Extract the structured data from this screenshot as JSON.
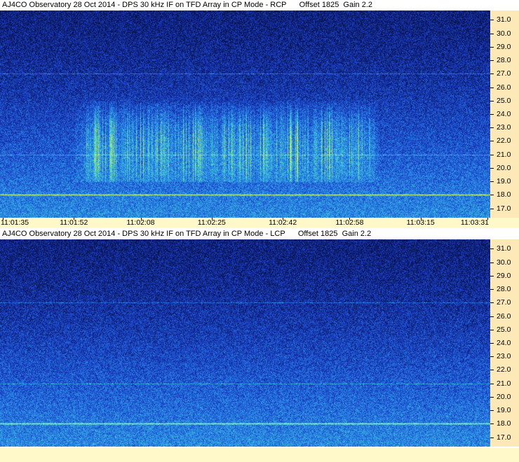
{
  "chart_data": [
    {
      "type": "heatmap",
      "title": "AJ4CO Observatory 28 Oct 2014 - DPS 30 kHz IF on TFD Array in CP Mode - RCP      Offset 1825  Gain 2.2",
      "polarization": "RCP",
      "offset": 1825,
      "gain": 2.2,
      "ylabel": "",
      "xlabel": "",
      "y_ticks": [
        "31.0",
        "30.0",
        "29.0",
        "28.0",
        "27.0",
        "26.0",
        "25.0",
        "24.0",
        "23.0",
        "22.0",
        "21.0",
        "20.0",
        "19.0",
        "18.0",
        "17.0"
      ],
      "x_ticks": [
        "11:01:35",
        "11:01:52",
        "11:02:08",
        "11:02:25",
        "11:02:42",
        "11:02:58",
        "11:03:15",
        "11:03:31"
      ],
      "ylim": [
        16.3,
        31.7
      ],
      "xlim": [
        "11:01:35",
        "11:03:31"
      ],
      "colormap": [
        "#0a1450",
        "#1a3cc8",
        "#2a8ce8",
        "#48d8d0",
        "#d8f040"
      ],
      "features": {
        "constant_lines_mhz": [
          18.0,
          21.0,
          27.0
        ],
        "burst_band_mhz": [
          19.0,
          26.0
        ],
        "burst_time": [
          "11:01:52",
          "11:03:05"
        ]
      }
    },
    {
      "type": "heatmap",
      "title": "AJ4CO Observatory 28 Oct 2014 - DPS 30 kHz IF on TFD Array in CP Mode - LCP      Offset 1825  Gain 2.2",
      "polarization": "LCP",
      "offset": 1825,
      "gain": 2.2,
      "ylabel": "",
      "xlabel": "",
      "y_ticks": [
        "31.0",
        "30.0",
        "29.0",
        "28.0",
        "27.0",
        "26.0",
        "25.0",
        "24.0",
        "23.0",
        "22.0",
        "21.0",
        "20.0",
        "19.0",
        "18.0",
        "17.0"
      ],
      "x_ticks": [],
      "ylim": [
        16.3,
        31.7
      ],
      "colormap": [
        "#0a1450",
        "#1a3cc8",
        "#2a8ce8",
        "#48d8d0",
        "#d8f040"
      ],
      "features": {
        "constant_lines_mhz": [
          18.0,
          21.0,
          27.0
        ],
        "burst_band_mhz": [],
        "burst_time": []
      }
    }
  ]
}
